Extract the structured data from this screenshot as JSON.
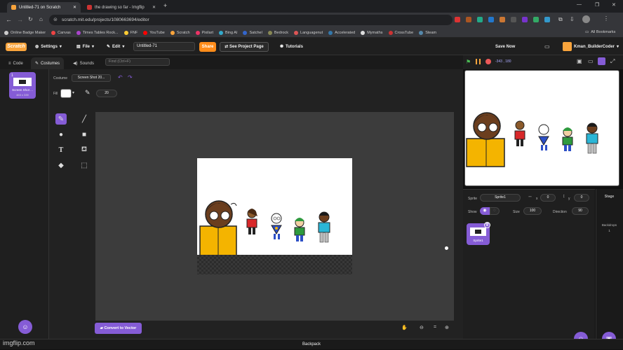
{
  "browser": {
    "tabs": [
      {
        "label": "Untitled-71 on Scratch",
        "active": true
      },
      {
        "label": "the drawing so far - Imgflip",
        "active": false
      }
    ],
    "url": "scratch.mit.edu/projects/1080663694/editor",
    "bookmarks": [
      "Online Badge Maker",
      "Canvas",
      "Times Tables Rock...",
      "FNF",
      "YouTube",
      "Scratch",
      "Pixilart",
      "Bing AI",
      "Satchel",
      "Bedrock",
      "Languagenut",
      "Accelerated",
      "Mymaths",
      "CrossTube",
      "Steam"
    ],
    "all_bookmarks": "All Bookmarks"
  },
  "menu": {
    "logo": "Scratch",
    "settings": "Settings",
    "file": "File",
    "edit": "Edit",
    "project_title": "Untitled-71",
    "share": "Share",
    "see_project": "See Project Page",
    "tutorials": "Tutorials",
    "save_now": "Save Now",
    "username": "Kman_BuilderCoder"
  },
  "editor_tabs": {
    "code": "Code",
    "costumes": "Costumes",
    "sounds": "Sounds"
  },
  "find_placeholder": "Find (Ctrl+F)",
  "costume": {
    "number": "1",
    "name": "Screen Shot 20...",
    "thumb_label": "Screen Shot ...",
    "thumb_size": "463 x 339"
  },
  "paint": {
    "costume_label": "Costume",
    "fill_label": "Fill",
    "outline_width": "20",
    "convert_button": "Convert to Vector"
  },
  "stage_controls": {
    "coords": "-343 , 180"
  },
  "sprite_info": {
    "sprite_label": "Sprite",
    "sprite_name": "Sprite1",
    "x_label": "x",
    "x_value": "0",
    "y_label": "y",
    "y_value": "0",
    "show_label": "Show",
    "size_label": "Size",
    "size_value": "100",
    "direction_label": "Direction",
    "direction_value": "90",
    "sprite_thumb_label": "Sprite1"
  },
  "stage_pane": {
    "title": "Stage",
    "backdrops_label": "Backdrops",
    "backdrops_count": "1"
  },
  "backpack": "Backpack",
  "watermark": "imgflip.com",
  "colors": {
    "accent": "#855cd6",
    "share": "#ff8c1a",
    "skin": "#6b3e1e",
    "shirt_yellow": "#f4b400"
  }
}
